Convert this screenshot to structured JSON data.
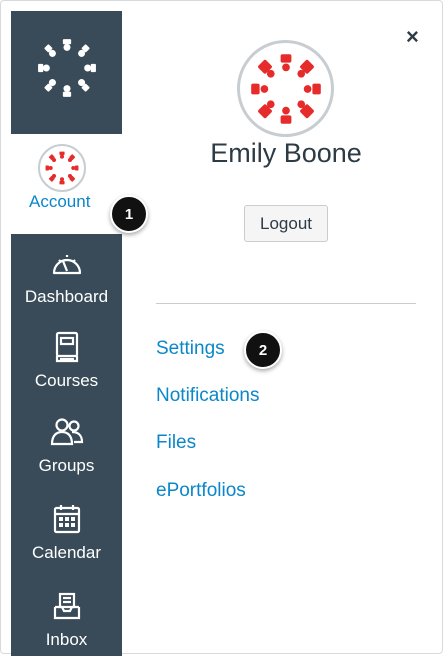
{
  "nav": {
    "logo_icon": "canvas-logo-icon",
    "account": {
      "label": "Account",
      "icon": "canvas-avatar-icon"
    },
    "items": [
      {
        "label": "Dashboard",
        "icon": "dashboard-icon"
      },
      {
        "label": "Courses",
        "icon": "book-icon"
      },
      {
        "label": "Groups",
        "icon": "groups-icon"
      },
      {
        "label": "Calendar",
        "icon": "calendar-icon"
      },
      {
        "label": "Inbox",
        "icon": "inbox-icon"
      }
    ]
  },
  "callouts": {
    "one": "1",
    "two": "2"
  },
  "tray": {
    "close_icon": "close-icon",
    "close_glyph": "×",
    "user_name": "Emily Boone",
    "logout_label": "Logout",
    "links": [
      "Settings",
      "Notifications",
      "Files",
      "ePortfolios"
    ]
  },
  "colors": {
    "nav_bg": "#394b58",
    "link": "#0b87c9",
    "brand_red": "#e62b2b",
    "text": "#2d3b45"
  }
}
